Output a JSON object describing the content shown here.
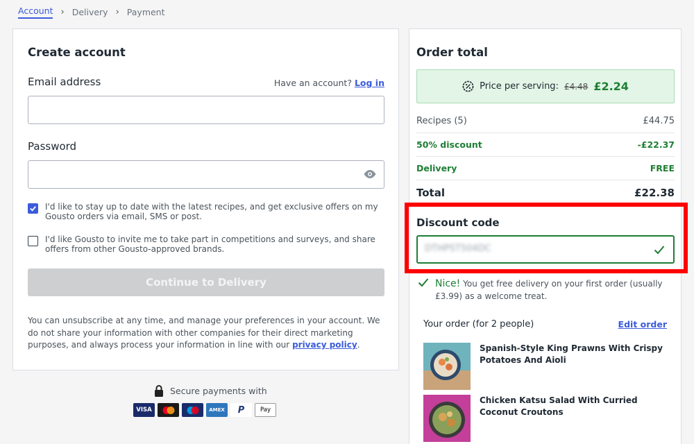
{
  "breadcrumb": {
    "items": [
      "Account",
      "Delivery",
      "Payment"
    ]
  },
  "create_account": {
    "title": "Create account",
    "email_label": "Email address",
    "have_account_text": "Have an account?",
    "login_link": "Log in",
    "email_value": "",
    "password_label": "Password",
    "password_value": "",
    "checkbox1_text": "I'd like to stay up to date with the latest recipes, and get exclusive offers on my Gousto orders via email, SMS or post.",
    "checkbox1_checked": true,
    "checkbox2_text": "I'd like Gousto to invite me to take part in competitions and surveys, and share offers from other Gousto-approved brands.",
    "checkbox2_checked": false,
    "continue_button": "Continue to Delivery",
    "unsubscribe_text": "You can unsubscribe at any time, and manage your preferences in your account. We do not share your information with other companies for their direct marketing purposes, and always process your information in line with our",
    "privacy_link": "privacy policy",
    "privacy_after": "."
  },
  "secure": {
    "text": "Secure payments with",
    "methods": [
      "VISA",
      "Mastercard",
      "Maestro",
      "AMEX",
      "PayPal",
      "Apple Pay"
    ]
  },
  "order_total": {
    "title": "Order total",
    "price_per_serving_label": "Price per serving:",
    "old_price": "£4.48",
    "new_price": "£2.24",
    "rows": [
      {
        "label": "Recipes (5)",
        "value": "£44.75"
      },
      {
        "label": "50% discount",
        "value": "-£22.37"
      },
      {
        "label": "Delivery",
        "value": "FREE"
      },
      {
        "label": "Total",
        "value": "£22.38"
      }
    ],
    "discount_label": "Discount code",
    "discount_value": "DTHPST504DC",
    "nice_word": "Nice!",
    "nice_text": "You get free delivery on your first order (usually £3.99) as a welcome treat.",
    "your_order_label": "Your order (for 2 people)",
    "edit_order": "Edit order",
    "recipes": [
      {
        "title": "Spanish-Style King Prawns With Crispy Potatoes And Aioli"
      },
      {
        "title": "Chicken Katsu Salad With Curried Coconut Croutons"
      }
    ]
  },
  "colors": {
    "accent": "#3b5bdb",
    "success": "#1e7e34",
    "highlight": "#ff0000"
  }
}
